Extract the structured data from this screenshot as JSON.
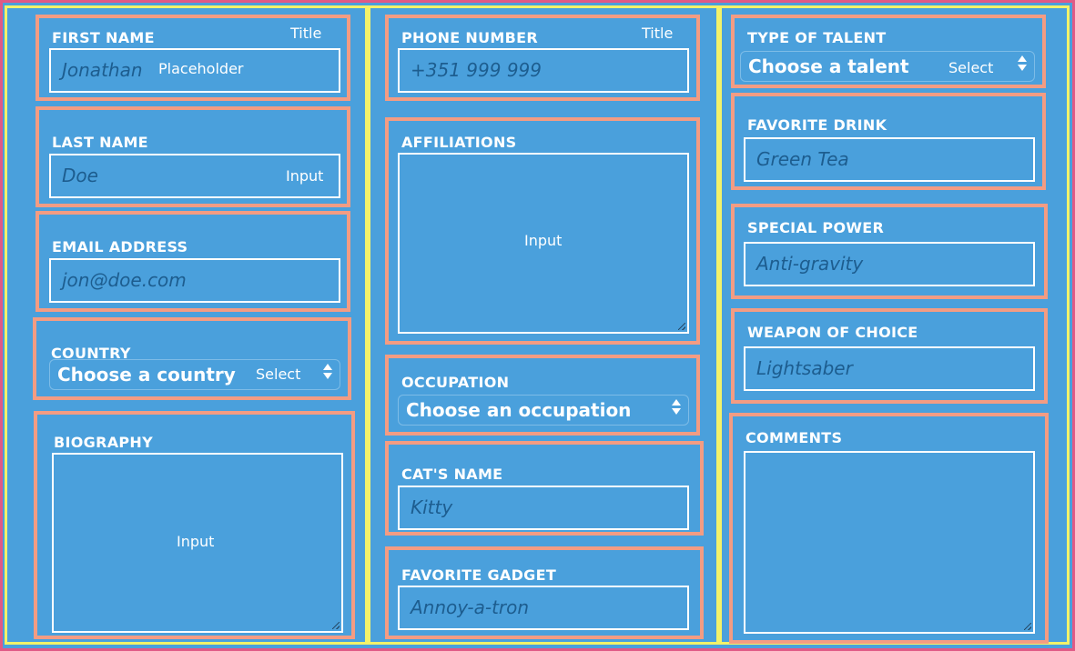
{
  "fields": {
    "first_name": {
      "label": "FIRST NAME",
      "value": "Jonathan",
      "annotation": "Title",
      "value_note": "Placeholder"
    },
    "last_name": {
      "label": "LAST NAME",
      "value": "Doe",
      "annotation": "Input"
    },
    "email": {
      "label": "EMAIL ADDRESS",
      "value": "jon@doe.com"
    },
    "country": {
      "label": "COUNTRY",
      "value": "Choose a country",
      "annotation": "Select"
    },
    "biography": {
      "label": "BIOGRAPHY",
      "annotation": "Input"
    },
    "phone": {
      "label": "PHONE NUMBER",
      "value": "+351 999 999",
      "annotation": "Title"
    },
    "affiliations": {
      "label": "AFFILIATIONS",
      "annotation": "Input"
    },
    "occupation": {
      "label": "OCCUPATION",
      "value": "Choose an occupation"
    },
    "cat_name": {
      "label": "CAT'S NAME",
      "value": "Kitty"
    },
    "gadget": {
      "label": "FAVORITE GADGET",
      "value": "Annoy-a-tron"
    },
    "talent": {
      "label": "TYPE OF TALENT",
      "value": "Choose a talent",
      "annotation": "Select"
    },
    "drink": {
      "label": "FAVORITE DRINK",
      "value": "Green Tea"
    },
    "power": {
      "label": "SPECIAL POWER",
      "value": "Anti-gravity"
    },
    "weapon": {
      "label": "WEAPON OF CHOICE",
      "value": "Lightsaber"
    },
    "comments": {
      "label": "COMMENTS"
    }
  },
  "colors": {
    "background": "#4aa0dc",
    "frame": "#e05a86",
    "column_border": "#f3f26a",
    "field_border": "#f39c83",
    "placeholder_text": "#1d5d8f"
  }
}
